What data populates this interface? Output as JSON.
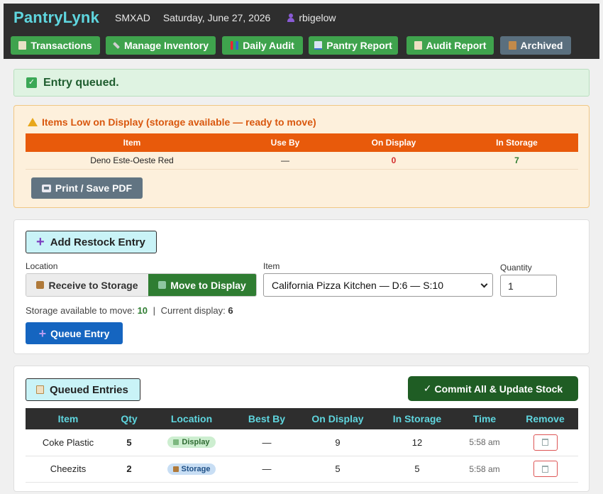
{
  "header": {
    "brand": "PantryLynk",
    "org": "SMXAD",
    "date": "Saturday, June 27, 2026",
    "user": "rbigelow"
  },
  "nav": [
    {
      "label": "Transactions",
      "icon": "ledger-icon"
    },
    {
      "label": "Manage Inventory",
      "icon": "tools-icon"
    },
    {
      "label": "Daily Audit",
      "icon": "bar-chart-icon"
    },
    {
      "label": "Pantry Report",
      "icon": "trend-chart-icon"
    },
    {
      "label": "Audit Report",
      "icon": "clipboard-icon"
    },
    {
      "label": "Archived",
      "icon": "box-icon"
    }
  ],
  "alert": {
    "text": "Entry queued."
  },
  "low_display": {
    "title": "Items Low on Display (storage available — ready to move)",
    "columns": [
      "Item",
      "Use By",
      "On Display",
      "In Storage"
    ],
    "rows": [
      {
        "item": "Deno Este-Oeste Red",
        "use_by": "—",
        "on_display": "0",
        "in_storage": "7"
      }
    ],
    "print_label": "Print / Save PDF"
  },
  "restock": {
    "heading": "Add Restock Entry",
    "location_label": "Location",
    "location_options": [
      "Receive to Storage",
      "Move to Display"
    ],
    "location_selected": "Move to Display",
    "item_label": "Item",
    "item_value": "California Pizza Kitchen — D:6 — S:10",
    "quantity_label": "Quantity",
    "quantity_value": "1",
    "avail_text": "Storage available to move:",
    "avail_value": "10",
    "sep": "|",
    "current_text": "Current display:",
    "current_value": "6",
    "queue_label": "Queue Entry"
  },
  "queued": {
    "heading": "Queued Entries",
    "commit_label": "Commit All & Update Stock",
    "columns": [
      "Item",
      "Qty",
      "Location",
      "Best By",
      "On Display",
      "In Storage",
      "Time",
      "Remove"
    ],
    "rows": [
      {
        "item": "Coke Plastic",
        "qty": "5",
        "location": "Display",
        "best_by": "—",
        "on_display": "9",
        "in_storage": "12",
        "time": "5:58 am"
      },
      {
        "item": "Cheezits",
        "qty": "2",
        "location": "Storage",
        "best_by": "—",
        "on_display": "5",
        "in_storage": "5",
        "time": "5:58 am"
      }
    ]
  },
  "colors": {
    "accent": "#5fd6df",
    "nav_green": "#3fa34d",
    "warning_orange": "#e85a0b",
    "commit_green": "#1f5d24",
    "queue_blue": "#1565c0"
  }
}
